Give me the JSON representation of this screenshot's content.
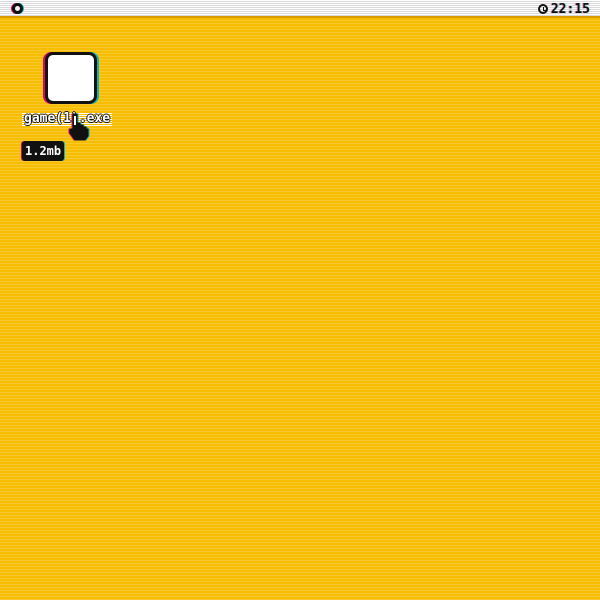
{
  "menubar": {
    "system_icon": "system-menu-icon",
    "clock_icon": "clock-icon",
    "clock_time": "22:15"
  },
  "desktop": {
    "background_color": "#f7bd00",
    "icons": [
      {
        "icon": "blank-file-icon",
        "name": "game(1).exe",
        "size": "1.2mb",
        "selected": true
      }
    ]
  },
  "cursor": {
    "icon": "hand-pointer-icon"
  }
}
